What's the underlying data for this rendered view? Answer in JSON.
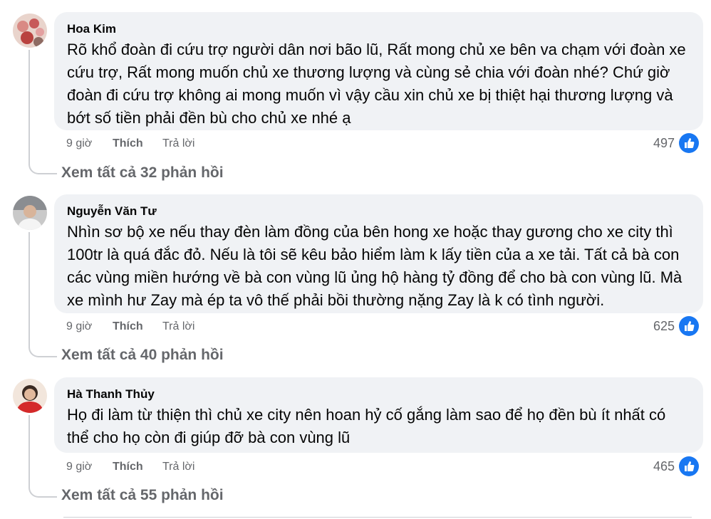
{
  "comments": [
    {
      "author": "Hoa Kim",
      "text": "Rõ khổ đoàn đi cứu trợ người dân nơi bão lũ, Rất mong chủ xe bên va chạm với đoàn xe cứu trợ, Rất mong muốn chủ xe thương lượng và cùng sẻ chia với đoàn nhé? Chứ giờ đoàn đi cứu trợ không ai mong muốn vì vậy cầu xin chủ xe bị thiệt hại thương lượng và bớt số tiền phải đền bù cho chủ xe nhé ạ",
      "time": "9 giờ",
      "like_label": "Thích",
      "reply_label": "Trả lời",
      "reaction_count": "497",
      "view_replies": "Xem tất cả 32 phản hồi"
    },
    {
      "author": "Nguyễn Văn Tư",
      "text": "Nhìn sơ bộ xe nếu thay đèn làm đồng của bên hong xe hoặc thay gương cho xe city thì 100tr là quá đắc đỏ. Nếu là tôi sẽ kêu bảo hiểm làm k lấy tiền của a xe tải. Tất cả bà con các vùng miền hướng về bà con vùng lũ ủng hộ hàng tỷ đồng để cho bà con vùng lũ. Mà xe mình hư Zay mà ép ta vô thế phải bồi thường nặng Zay là k có tình người.",
      "time": "9 giờ",
      "like_label": "Thích",
      "reply_label": "Trả lời",
      "reaction_count": "625",
      "view_replies": "Xem tất cả 40 phản hồi"
    },
    {
      "author": "Hà Thanh Thủy",
      "text": "Họ đi làm từ thiện thì chủ xe city nên hoan hỷ cố gắng làm sao để họ đền bù ít nhất có thể cho họ còn đi giúp đỡ bà con vùng lũ",
      "time": "9 giờ",
      "like_label": "Thích",
      "reply_label": "Trả lời",
      "reaction_count": "465",
      "view_replies": "Xem tất cả 55 phản hồi"
    }
  ],
  "icons": {
    "reaction": "like-thumbs-up-icon"
  },
  "colors": {
    "bubble": "#f0f2f5",
    "meta_text": "#65676b",
    "like_blue": "#1877f2"
  }
}
